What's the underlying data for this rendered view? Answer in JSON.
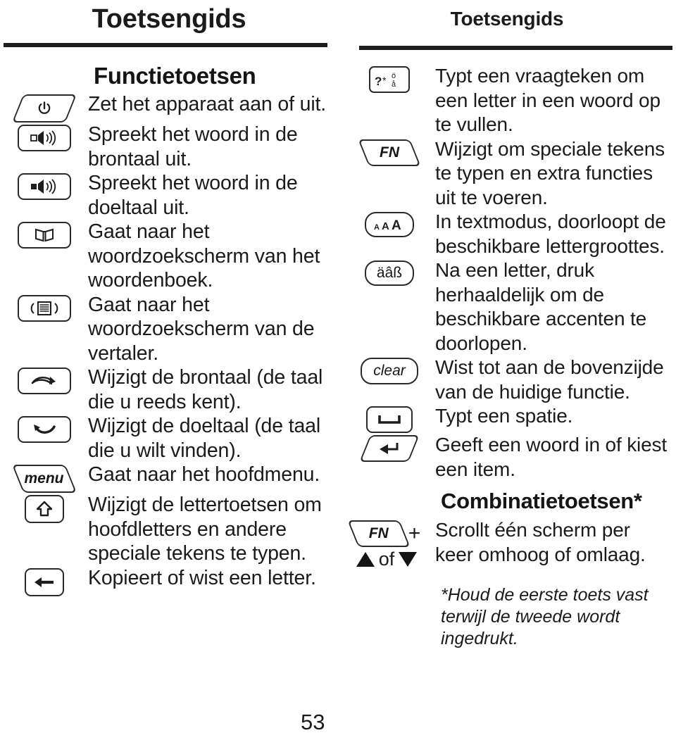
{
  "page": {
    "number": "53"
  },
  "left_column": {
    "header": "Toetsengids",
    "section_title": "Functietoetsen",
    "rows": [
      {
        "key_icon": "power-key-icon",
        "key_label": "",
        "description": "Zet het apparaat aan of uit."
      },
      {
        "key_icon": "speaker-outline-key-icon",
        "key_label": "",
        "description": "Spreekt het woord in de brontaal uit."
      },
      {
        "key_icon": "speaker-filled-key-icon",
        "key_label": "",
        "description": "Spreekt het woord in de doeltaal uit."
      },
      {
        "key_icon": "book-key-icon",
        "key_label": "",
        "description": "Gaat naar het woordzoekscherm van het woordenboek."
      },
      {
        "key_icon": "speaking-document-key-icon",
        "key_label": "",
        "description": "Gaat naar het woordzoekscherm van de vertaler."
      },
      {
        "key_icon": "source-language-key-icon",
        "key_label": "",
        "description": "Wijzigt de brontaal (de taal die u reeds kent)."
      },
      {
        "key_icon": "target-language-key-icon",
        "key_label": "",
        "description": "Wijzigt de doeltaal (de taal die u wilt vinden)."
      },
      {
        "key_icon": "menu-key-icon",
        "key_label": "menu",
        "description": "Gaat naar het hoofdmenu."
      },
      {
        "key_icon": "shift-key-icon",
        "key_label": "",
        "description": "Wijzigt de lettertoetsen om hoofdletters en andere speciale tekens te typen."
      },
      {
        "key_icon": "backspace-key-icon",
        "key_label": "",
        "description": "Kopieert of wist een letter."
      }
    ]
  },
  "right_column": {
    "header": "Toetsengids",
    "rows": [
      {
        "key_icon": "question-star-accent-key-icon",
        "key_label": "?*",
        "description": "Typt een vraagteken om een letter in een woord op te vullen."
      },
      {
        "key_icon": "fn-key-icon",
        "key_label": "FN",
        "description": "Wijzigt om speciale tekens te typen en extra functies uit te voeren."
      },
      {
        "key_icon": "font-size-key-icon",
        "key_label": "AAA",
        "description": "In textmodus, doorloopt de beschikbare lettergroottes."
      },
      {
        "key_icon": "accent-key-icon",
        "key_label": "äâß",
        "description": "Na een letter,  druk herhaaldelijk om de beschikbare accenten te doorlopen."
      },
      {
        "key_icon": "clear-key-icon",
        "key_label": "clear",
        "description": "Wist tot aan de bovenzijde van de huidige functie."
      },
      {
        "key_icon": "space-key-icon",
        "key_label": "",
        "description": "Typt een spatie."
      },
      {
        "key_icon": "enter-key-icon",
        "key_label": "",
        "description": "Geeft een woord in of kiest een item."
      }
    ],
    "combo_section_title": "Combinatietoetsen*",
    "combo_row": {
      "key_label": "FN",
      "plus": "+",
      "or_label": "of",
      "description": "Scrollt één scherm per keer omhoog of omlaag."
    },
    "footnote": "*Houd de eerste toets vast terwijl de tweede wordt ingedrukt."
  }
}
